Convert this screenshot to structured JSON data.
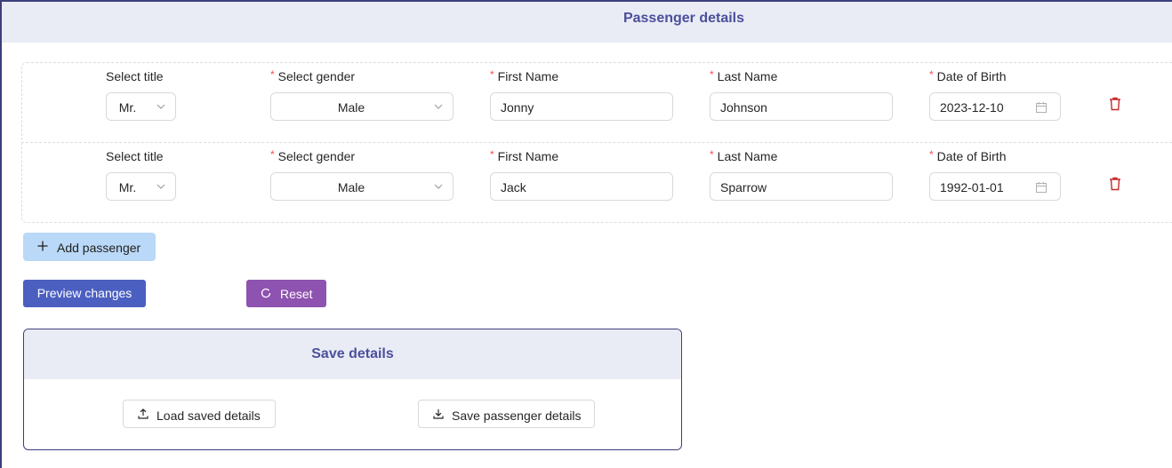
{
  "header": {
    "title": "Passenger details"
  },
  "form": {
    "labels": {
      "title": "Select title",
      "gender": "Select gender",
      "first_name": "First Name",
      "last_name": "Last Name",
      "dob": "Date of Birth"
    },
    "required_mark": "*",
    "passengers": [
      {
        "title": "Mr.",
        "gender": "Male",
        "first_name": "Jonny",
        "last_name": "Johnson",
        "dob": "2023-12-10"
      },
      {
        "title": "Mr.",
        "gender": "Male",
        "first_name": "Jack",
        "last_name": "Sparrow",
        "dob": "1992-01-01"
      }
    ]
  },
  "actions": {
    "add_passenger": "Add passenger",
    "preview": "Preview changes",
    "reset": "Reset"
  },
  "save_panel": {
    "title": "Save details",
    "load": "Load saved details",
    "save": "Save passenger details"
  },
  "icons": {
    "delete": "trash-icon",
    "calendar": "calendar-icon",
    "dropdown": "chevron-down-icon",
    "add": "plus-icon",
    "reset": "reload-icon",
    "upload": "upload-icon",
    "download": "download-icon"
  },
  "colors": {
    "header_bg": "#eaecf5",
    "title_text": "#4b4f9c",
    "add_button_bg": "#bad8f7",
    "preview_button_bg": "#4b5fc1",
    "reset_button_bg": "#8e52b0",
    "delete_icon": "#c62828",
    "required_mark": "#ff4d4f"
  }
}
